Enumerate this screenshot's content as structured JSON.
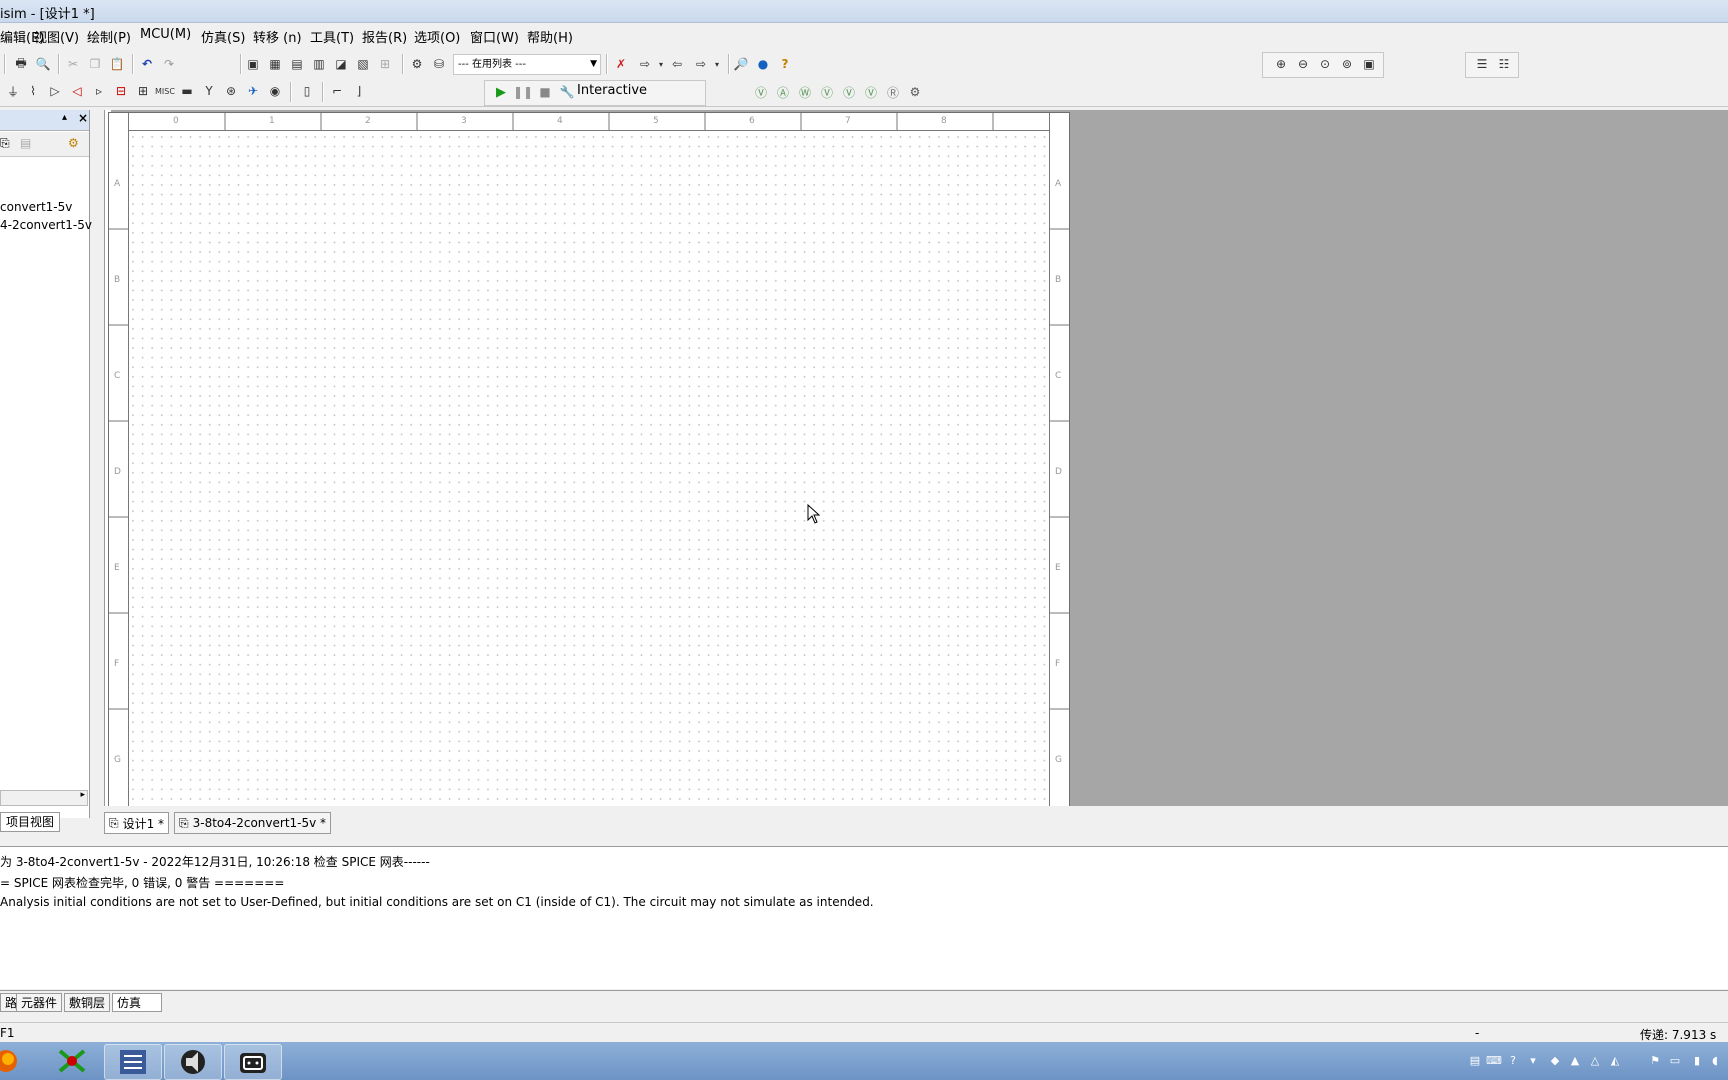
{
  "window": {
    "title": "isim - [设计1 *]"
  },
  "menu": [
    "编辑(E)",
    "视图(V)",
    "绘制(P)",
    "MCU(M)",
    "仿真(S)",
    "转移 (n)",
    "工具(T)",
    "报告(R)",
    "选项(O)",
    "窗口(W)",
    "帮助(H)"
  ],
  "toolbar": {
    "netlist_dropdown": "--- 在用列表 ---",
    "sim_mode_label": "Interactive"
  },
  "sidebar": {
    "items": [
      "convert1-5v",
      "4-2convert1-5v"
    ],
    "tab_label": "项目视图"
  },
  "sheet": {
    "col_labels": [
      "0",
      "1",
      "2",
      "3",
      "4",
      "5",
      "6",
      "7",
      "8"
    ],
    "row_labels": [
      "A",
      "B",
      "C",
      "D",
      "E",
      "F",
      "G"
    ]
  },
  "doc_tabs": [
    "设计1 *",
    "3-8to4-2convert1-5v *"
  ],
  "output": {
    "lines": [
      "为 3-8to4-2convert1-5v - 2022年12月31日, 10:26:18 检查 SPICE 网表------",
      "= SPICE 网表检查完毕, 0 错误, 0 警告 =======",
      "Analysis initial conditions are not set to User-Defined, but initial conditions are set on C1 (inside of C1). The circuit may not simulate as intended."
    ],
    "tabs": [
      "路",
      "元器件",
      "敷铜层",
      "仿真"
    ]
  },
  "status": {
    "left": "F1",
    "middle": "-",
    "right": "传递: 7.913 s"
  },
  "colors": {
    "canvas_bg": "#a6a6a6",
    "taskbar": "#7a9dcc"
  }
}
